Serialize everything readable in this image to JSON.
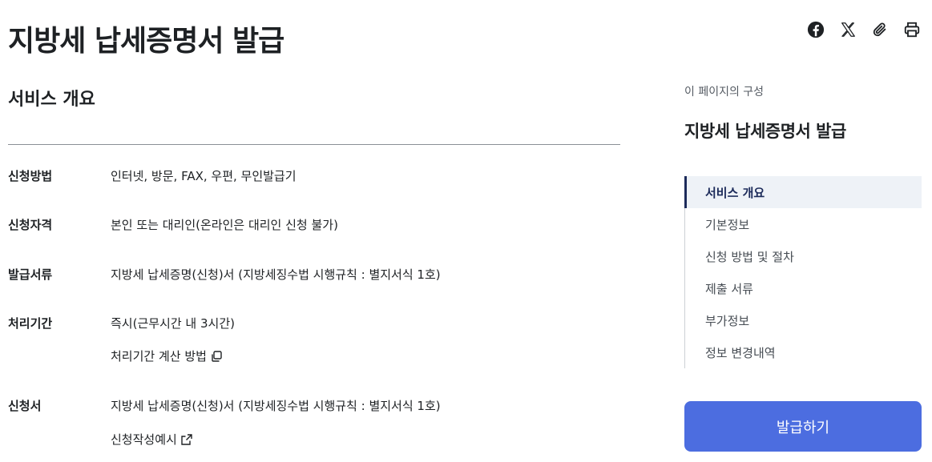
{
  "page": {
    "title": "지방세 납세증명서 발급"
  },
  "share_tools": [
    {
      "name": "facebook-icon"
    },
    {
      "name": "x-icon"
    },
    {
      "name": "link-icon"
    },
    {
      "name": "print-icon"
    }
  ],
  "overview": {
    "section_title": "서비스 개요",
    "rows": [
      {
        "label": "신청방법",
        "value": "인터넷, 방문, FAX, 우편, 무인발급기"
      },
      {
        "label": "신청자격",
        "value": "본인 또는 대리인(온라인은 대리인 신청 불가)"
      },
      {
        "label": "발급서류",
        "value": "지방세 납세증명(신청)서 (지방세징수법 시행규칙 : 별지서식 1호)"
      },
      {
        "label": "처리기간",
        "value": "즉시(근무시간 내 3시간)",
        "link": "처리기간 계산 방법",
        "link_icon": "copy-icon"
      },
      {
        "label": "신청서",
        "value": "지방세 납세증명(신청)서 (지방세징수법 시행규칙 : 별지서식 1호)",
        "link": "신청작성예시",
        "link_icon": "external-link-icon"
      }
    ]
  },
  "toc": {
    "caption": "이 페이지의 구성",
    "title": "지방세 납세증명서 발급",
    "items": [
      {
        "label": "서비스 개요",
        "active": true
      },
      {
        "label": "기본정보"
      },
      {
        "label": "신청 방법 및 절차"
      },
      {
        "label": "제출 서류"
      },
      {
        "label": "부가정보"
      },
      {
        "label": "정보 변경내역"
      }
    ]
  },
  "actions": {
    "issue_button": "발급하기"
  },
  "colors": {
    "primary_button": "#4c6de0",
    "toc_active": "#1c2b5a",
    "text": "#1e2124"
  }
}
